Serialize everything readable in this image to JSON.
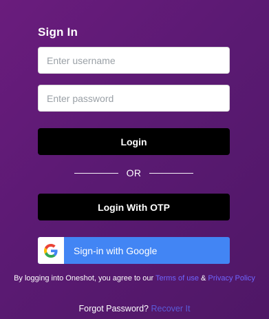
{
  "login": {
    "title": "Sign In",
    "username_placeholder": "Enter username",
    "password_placeholder": "Enter password",
    "login_label": "Login",
    "or_text": "OR",
    "otp_label": "Login With OTP",
    "google_label": "Sign-in with Google",
    "google_icon": "google-g-icon"
  },
  "terms": {
    "prefix": "By logging into Oneshot, you agree to our",
    "terms_link": "Terms of use",
    "ampersand": "&",
    "privacy_link": "Privacy Policy"
  },
  "forgot": {
    "text": "Forgot Password?",
    "link": "Recover It"
  },
  "colors": {
    "background": "#5b1a73",
    "button": "#000000",
    "google_blue": "#4285f4",
    "link": "#6f66ff"
  }
}
